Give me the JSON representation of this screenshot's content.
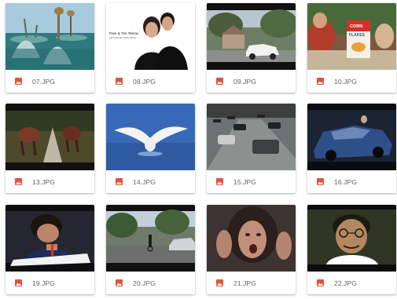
{
  "files": [
    {
      "name": "07.JPG",
      "file_icon": "image-file-icon",
      "thumbnail": "surreal-water-sculpture-scene"
    },
    {
      "name": "08.JPG",
      "file_icon": "image-file-icon",
      "thumbnail": "portrait-couple",
      "overlay_text": [
        "Pam & Tim Tebow",
        "2007 Heisman Trophy Winner"
      ]
    },
    {
      "name": "09.JPG",
      "file_icon": "image-file-icon",
      "thumbnail": "white-suv-street"
    },
    {
      "name": "10.JPG",
      "file_icon": "image-file-icon",
      "thumbnail": "corn-flakes-breakfast",
      "overlay_text": [
        "CORN",
        "FLAKES"
      ]
    },
    {
      "name": "13.JPG",
      "file_icon": "image-file-icon",
      "thumbnail": "horses-running"
    },
    {
      "name": "14.JPG",
      "file_icon": "image-file-icon",
      "thumbnail": "swan-on-water"
    },
    {
      "name": "15.JPG",
      "file_icon": "image-file-icon",
      "thumbnail": "cars-on-road"
    },
    {
      "name": "16.JPG",
      "file_icon": "image-file-icon",
      "thumbnail": "blue-car-night"
    },
    {
      "name": "19.JPG",
      "file_icon": "image-file-icon",
      "thumbnail": "boy-writing"
    },
    {
      "name": "20.JPG",
      "file_icon": "image-file-icon",
      "thumbnail": "cyclist-street"
    },
    {
      "name": "21.JPG",
      "file_icon": "image-file-icon",
      "thumbnail": "woman-screaming"
    },
    {
      "name": "22.JPG",
      "file_icon": "image-file-icon",
      "thumbnail": "man-with-glasses",
      "overlay_text": [
        "I want to taste the best"
      ]
    }
  ],
  "colors": {
    "file_icon": "#e0533f",
    "filename_text": "#5f6368"
  }
}
